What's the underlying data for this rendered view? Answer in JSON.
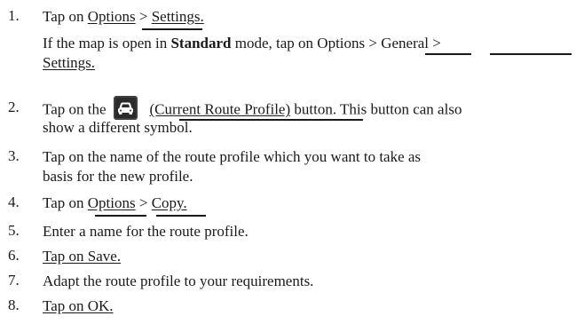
{
  "steps": [
    {
      "number": "1.",
      "line1": {
        "prefix": "Tap on ",
        "link_a": "Options",
        "sep": " > ",
        "link_b": "Settings."
      },
      "line2": {
        "pre": "If the map is open in ",
        "bold": "Standard",
        "post": " mode, tap on Options > General >"
      },
      "line3": {
        "link": "Settings."
      }
    },
    {
      "number": "2.",
      "line1": {
        "prefix": "Tap on the",
        "icon": "car-icon",
        "link": "(Current Route Profile)",
        "suffix": " button. This button can also"
      },
      "line2": {
        "text": "show a different symbol."
      }
    },
    {
      "number": "3.",
      "line1": {
        "text": "Tap on the name of the route profile which you want to take as"
      },
      "line2": {
        "text": "basis for the new profile."
      }
    },
    {
      "number": "4.",
      "line1": {
        "prefix": "Tap on ",
        "link_a": "Options",
        "sep": " > ",
        "link_b": "Copy."
      }
    },
    {
      "number": "5.",
      "line1": {
        "text": "Enter a name for the route profile."
      }
    },
    {
      "number": "6.",
      "line1": {
        "link": "Tap on Save."
      }
    },
    {
      "number": "7.",
      "line1": {
        "text": "Adapt the route profile to your requirements."
      }
    },
    {
      "number": "8.",
      "line1": {
        "link": "Tap on OK."
      }
    }
  ],
  "colors": {
    "text": "#1a1a1a",
    "icon_bg": "#2b2b2b",
    "icon_fg": "#ffffff"
  }
}
